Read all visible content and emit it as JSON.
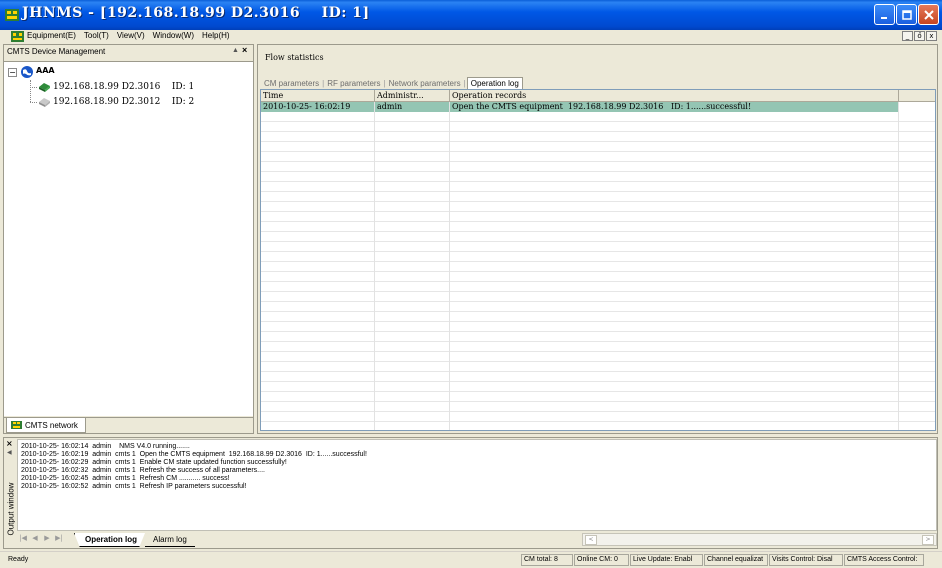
{
  "window": {
    "title": "JHNMS - [192.168.18.99 D2.3016    ID: 1]"
  },
  "menu": {
    "items": [
      "Equipment(E)",
      "Tool(T)",
      "View(V)",
      "Window(W)",
      "Help(H)"
    ],
    "mdi_controls": [
      "_",
      "ő",
      "x"
    ]
  },
  "left_panel": {
    "title": "CMTS Device Management",
    "pin": "▲",
    "close": "×",
    "tree": {
      "expander": "−",
      "root": "AAA",
      "devices": [
        {
          "label": "192.168.18.99 D2.3016    ID: 1",
          "icon": "device-online-icon"
        },
        {
          "label": "192.168.18.90 D2.3012    ID: 2",
          "icon": "device-offline-icon"
        }
      ]
    },
    "tab": "CMTS network"
  },
  "right_panel": {
    "title": "Flow statistics",
    "tabs": [
      "CM parameters",
      "RF parameters",
      "Network parameters",
      "Operation log"
    ],
    "active_tab": "Operation log",
    "grid": {
      "columns": [
        "Time",
        "Administr...",
        "Operation records"
      ],
      "rows": [
        [
          "2010-10-25- 16:02:19",
          "admin",
          "Open the CMTS equipment  192.168.18.99 D2.3016   ID: 1......successful!"
        ]
      ]
    }
  },
  "output": {
    "title": "Output window",
    "close": "×",
    "pin": "◀",
    "lines": [
      "2010-10-25- 16:02:14  admin    NMS V4.0 running.......",
      "2010-10-25- 16:02:19  admin  cmts 1  Open the CMTS equipment  192.168.18.99 D2.3016  ID: 1......successful!",
      "2010-10-25- 16:02:29  admin  cmts 1  Enable CM state updated function successfully!",
      "2010-10-25- 16:02:32  admin  cmts 1  Refresh the success of all parameters....",
      "2010-10-25- 16:02:45  admin  cmts 1  Refresh CM ........... success!",
      "2010-10-25- 16:02:52  admin  cmts 1  Refresh IP parameters successful!"
    ],
    "nav": [
      "|◀",
      "◀",
      "▶",
      "▶|"
    ],
    "tabs": [
      "Operation log",
      "Alarm log"
    ],
    "active_tab": "Operation log",
    "scroll_left": "<",
    "scroll_right": ">"
  },
  "status": {
    "ready": "Ready",
    "cells": [
      "CM total: 8",
      "Online CM: 0",
      "Live Update: Enabl",
      "Channel equalizat",
      "Visits Control: Disal",
      "CMTS Access Control:"
    ]
  },
  "colors": {
    "title_bar": "#0055e5",
    "selected_row": "#94c5b3",
    "close_button": "#d4532e"
  }
}
